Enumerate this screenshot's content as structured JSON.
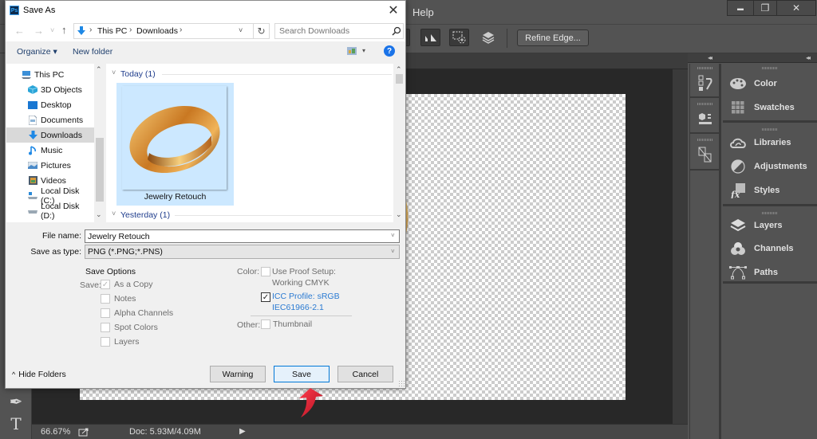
{
  "photoshop": {
    "menu": {
      "help_label": "Help"
    },
    "window_controls": {
      "minimize": "▬",
      "restore": "❐",
      "close": "✕"
    },
    "options_bar": {
      "refine_edge_label": "Refine Edge..."
    },
    "tools": {
      "pen_icon": "✒",
      "type_icon": "T"
    },
    "status_bar": {
      "zoom": "66.67%",
      "doc_size": "Doc: 5.93M/4.09M",
      "arrow": "▶"
    },
    "panels": {
      "collapse": "◂◂",
      "groups": [
        {
          "items": [
            {
              "label": "Color",
              "icon": "palette-icon"
            },
            {
              "label": "Swatches",
              "icon": "swatches-icon"
            }
          ]
        },
        {
          "items": [
            {
              "label": "Libraries",
              "icon": "libraries-icon"
            },
            {
              "label": "Adjustments",
              "icon": "adjustments-icon"
            },
            {
              "label": "Styles",
              "icon": "styles-icon"
            }
          ]
        },
        {
          "items": [
            {
              "label": "Layers",
              "icon": "layers-icon"
            },
            {
              "label": "Channels",
              "icon": "channels-icon"
            },
            {
              "label": "Paths",
              "icon": "paths-icon"
            }
          ]
        }
      ],
      "icon_column": [
        "history-icon",
        "properties-icon",
        "transform-icon"
      ]
    }
  },
  "dialog": {
    "title": "Save As",
    "app_badge": "Ps",
    "close_label": "✕",
    "nav": {
      "back": "←",
      "forward": "→",
      "recent": "˅",
      "up": "↑",
      "breadcrumb": [
        "This PC",
        "Downloads"
      ],
      "separator": "›",
      "refresh": "↻",
      "search_placeholder": "Search Downloads"
    },
    "commands": {
      "organize": "Organize ▾",
      "new_folder": "New folder",
      "view_dropdown": "▾",
      "help": "?"
    },
    "nav_pane": {
      "items": [
        {
          "label": "This PC",
          "icon": "computer-icon",
          "selected": false
        },
        {
          "label": "3D Objects",
          "icon": "3d-objects-icon",
          "selected": false
        },
        {
          "label": "Desktop",
          "icon": "desktop-icon",
          "selected": false
        },
        {
          "label": "Documents",
          "icon": "documents-icon",
          "selected": false
        },
        {
          "label": "Downloads",
          "icon": "downloads-icon",
          "selected": true
        },
        {
          "label": "Music",
          "icon": "music-icon",
          "selected": false
        },
        {
          "label": "Pictures",
          "icon": "pictures-icon",
          "selected": false
        },
        {
          "label": "Videos",
          "icon": "videos-icon",
          "selected": false
        },
        {
          "label": "Local Disk (C:)",
          "icon": "disk-c-icon",
          "selected": false
        },
        {
          "label": "Local Disk (D:)",
          "icon": "disk-d-icon",
          "selected": false
        }
      ]
    },
    "file_groups": [
      {
        "header": "Today (1)",
        "files": [
          {
            "name": "Jewelry Retouch",
            "selected": true
          }
        ]
      },
      {
        "header": "Yesterday (1)",
        "files": []
      }
    ],
    "form": {
      "file_name_label": "File name:",
      "file_name_value": "Jewelry Retouch",
      "save_type_label": "Save as type:",
      "save_type_value": "PNG (*.PNG;*.PNS)"
    },
    "save_options": {
      "heading": "Save Options",
      "save_label": "Save:",
      "options": [
        {
          "label": "As a Copy",
          "checked": true,
          "disabled": true
        },
        {
          "label": "Notes",
          "checked": false,
          "disabled": true
        },
        {
          "label": "Alpha Channels",
          "checked": false,
          "disabled": true
        },
        {
          "label": "Spot Colors",
          "checked": false,
          "disabled": true
        },
        {
          "label": "Layers",
          "checked": false,
          "disabled": true
        }
      ],
      "color_label": "Color:",
      "proof_setup_line1": "Use Proof Setup:",
      "proof_setup_line2": "Working CMYK",
      "proof_setup_checked": false,
      "icc_line1": "ICC Profile:  sRGB",
      "icc_line2": "IEC61966-2.1",
      "icc_checked": true,
      "other_label": "Other:",
      "thumbnail_label": "Thumbnail",
      "thumbnail_checked": false
    },
    "footer": {
      "hide_folders": "Hide Folders",
      "hide_folders_chevron": "^",
      "warning_label": "Warning",
      "save_label": "Save",
      "cancel_label": "Cancel"
    }
  },
  "colors": {
    "ps_bg": "#535353",
    "canvas_bg": "#282828",
    "dialog_bg": "#f0f0f0",
    "selection_blue": "#cce8ff",
    "link_blue": "#2a7ad2",
    "annotation_red": "#e0182d"
  }
}
